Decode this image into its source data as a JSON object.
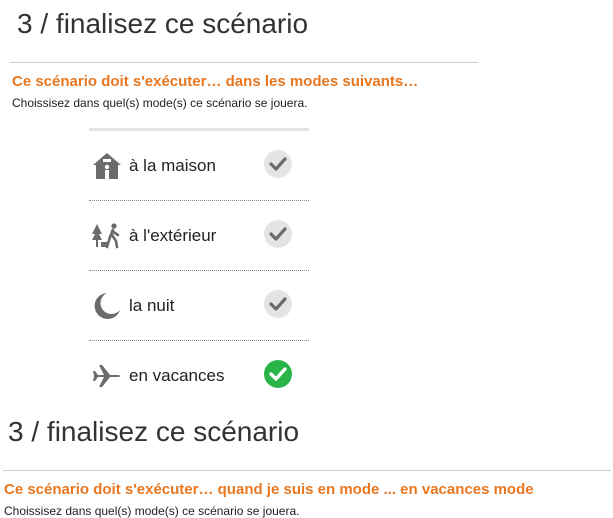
{
  "step1": {
    "title": "3 / finalisez ce scénario",
    "heading": "Ce scénario doit s'exécuter… dans les modes suivants…",
    "subtitle": "Choissisez dans quel(s) mode(s) ce scénario se jouera."
  },
  "modes": [
    {
      "label": "à la maison",
      "icon": "house-icon",
      "selected": false
    },
    {
      "label": "à l'extérieur",
      "icon": "outdoor-walker-icon",
      "selected": false
    },
    {
      "label": "la nuit",
      "icon": "moon-icon",
      "selected": false
    },
    {
      "label": "en vacances",
      "icon": "airplane-icon",
      "selected": true
    }
  ],
  "colors": {
    "accent": "#e87722",
    "check_on": "#28b446",
    "check_off": "#e4e4e4",
    "icon": "#6b6b6b"
  },
  "step2": {
    "title": "3 / finalisez ce scénario",
    "heading": "Ce scénario doit s'exécuter… quand je suis en mode ... en vacances mode",
    "subtitle": "Choissisez dans quel(s) mode(s) ce scénario se jouera."
  }
}
